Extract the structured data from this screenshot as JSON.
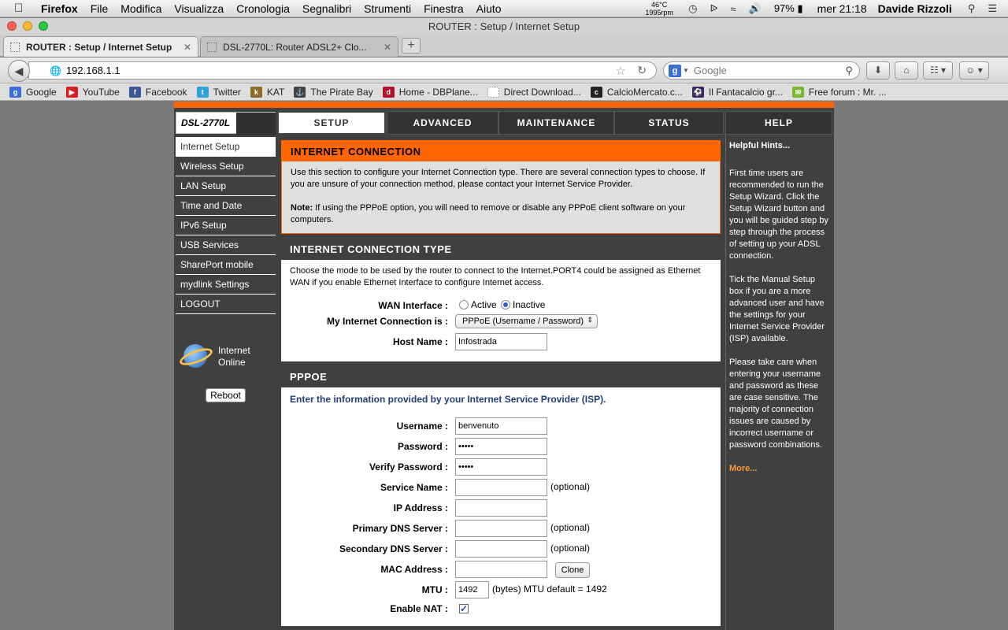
{
  "menubar": {
    "app": "Firefox",
    "items": [
      "File",
      "Modifica",
      "Visualizza",
      "Cronologia",
      "Segnalibri",
      "Strumenti",
      "Finestra",
      "Aiuto"
    ],
    "temp": "46°C",
    "rpm": "1995rpm",
    "battery": "97%",
    "clock": "mer 21:18",
    "user": "Davide Rizzoli"
  },
  "window": {
    "title": "ROUTER : Setup / Internet Setup"
  },
  "tabs": [
    {
      "label": "ROUTER : Setup / Internet Setup",
      "active": true
    },
    {
      "label": "DSL-2770L: Router ADSL2+ Clo...",
      "active": false
    }
  ],
  "navbar": {
    "url": "192.168.1.1",
    "search_placeholder": "Google"
  },
  "bookmarks": [
    {
      "label": "Google",
      "icon": "google-icon",
      "color": "#3a6fd8"
    },
    {
      "label": "YouTube",
      "icon": "youtube-icon",
      "color": "#d62121"
    },
    {
      "label": "Facebook",
      "icon": "facebook-icon",
      "color": "#3b5998"
    },
    {
      "label": "Twitter",
      "icon": "twitter-icon",
      "color": "#33a3d6"
    },
    {
      "label": "KAT",
      "icon": "kat-icon",
      "color": "#8a6b2a"
    },
    {
      "label": "The Pirate Bay",
      "icon": "pirate-ship-icon",
      "color": "#444444"
    },
    {
      "label": "Home - DBPlane...",
      "icon": "dbplanet-icon",
      "color": "#b3102a"
    },
    {
      "label": "Direct Download...",
      "icon": "blank-page-icon",
      "color": "#bbbbbb"
    },
    {
      "label": "CalcioMercato.c...",
      "icon": "calciomercato-icon",
      "color": "#222222"
    },
    {
      "label": "Il Fantacalcio gr...",
      "icon": "fantacalcio-icon",
      "color": "#442266"
    },
    {
      "label": "Free forum : Mr. ...",
      "icon": "forum-icon",
      "color": "#7cb82f"
    }
  ],
  "router": {
    "model": "DSL-2770L",
    "top_tabs": [
      "SETUP",
      "ADVANCED",
      "MAINTENANCE",
      "STATUS",
      "HELP"
    ],
    "sidebar": [
      "Internet Setup",
      "Wireless Setup",
      "LAN Setup",
      "Time and Date",
      "IPv6 Setup",
      "USB Services",
      "SharePort mobile",
      "mydlink Settings",
      "LOGOUT"
    ],
    "status_line1": "Internet",
    "status_line2": "Online",
    "reboot": "Reboot",
    "internet_connection": {
      "title": "INTERNET CONNECTION",
      "text": "Use this section to configure your Internet Connection type. There are several connection types to choose. If you are unsure of your connection method, please contact your Internet Service Provider.",
      "note_label": "Note:",
      "note_text": " If using the PPPoE option, you will need to remove or disable any PPPoE client software on your computers."
    },
    "connection_type": {
      "title": "INTERNET CONNECTION TYPE",
      "text": "Choose the mode to be used by the router to connect to the Internet.PORT4 could be assigned as Ethernet WAN if you enable Ethernet Interface to configure Internet access.",
      "wan_label": "WAN Interface :",
      "wan_active": "Active",
      "wan_inactive": "Inactive",
      "conn_label": "My Internet Connection is :",
      "conn_value": "PPPoE (Username / Password)",
      "host_label": "Host Name :",
      "host_value": "Infostrada"
    },
    "pppoe": {
      "title": "PPPOE",
      "intro": "Enter the information provided by your Internet Service Provider (ISP).",
      "username_label": "Username :",
      "username_value": "benvenuto",
      "password_label": "Password :",
      "password_value": "•••••",
      "verify_label": "Verify Password :",
      "verify_value": "•••••",
      "service_label": "Service Name :",
      "ip_label": "IP Address :",
      "dns1_label": "Primary DNS Server :",
      "dns2_label": "Secondary DNS Server :",
      "mac_label": "MAC Address :",
      "clone": "Clone",
      "optional": "(optional)",
      "mtu_label": "MTU :",
      "mtu_value": "1492",
      "mtu_note": "(bytes) MTU default = 1492",
      "nat_label": "Enable NAT :"
    },
    "hints": {
      "title": "Helpful Hints...",
      "p1": "First time users are recommended to run the Setup Wizard. Click the Setup Wizard button and you will be guided step by step through the process of setting up your ADSL connection.",
      "p2": "Tick the Manual Setup box if you are a more advanced user and have the settings for your Internet Service Provider (ISP) available.",
      "p3": "Please take care when entering your username and password as these are case sensitive. The majority of connection issues are caused by incorrect username or password combinations.",
      "more": "More..."
    }
  }
}
